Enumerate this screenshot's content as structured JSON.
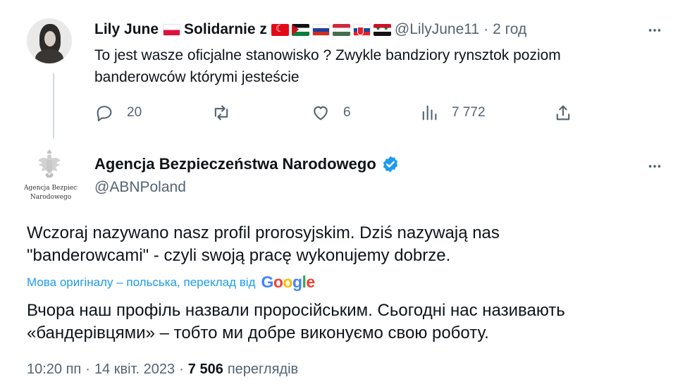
{
  "reply": {
    "display_name": "Lily June",
    "name_suffix": "Solidarnie z",
    "flags": [
      "flag-pl",
      "flag-tr",
      "flag-eh",
      "flag-ru",
      "flag-hu",
      "flag-sk",
      "flag-sy"
    ],
    "handle": "@LilyJune11",
    "separator": "·",
    "time": "2 год",
    "text_line1": "To jest wasze oficjalne stanowisko ? Zwykle bandziory rynsztok poziom",
    "text_line2": "banderowców którymi jesteście",
    "actions": {
      "replies": "20",
      "retweets": "",
      "likes": "6",
      "views": "7 772"
    }
  },
  "main": {
    "display_name": "Agencja Bezpieczeństwa Narodowego",
    "handle": "@ABNPoland",
    "avatar_line1": "Agencja Bezpieczeństwa",
    "avatar_line2": "Narodowego",
    "text_pl_line1": "Wczoraj nazywano nasz profil prorosyjskim. Dziś nazywają nas",
    "text_pl_line2": "\"banderowcami\" - czyli swoją pracę wykonujemy dobrze.",
    "translate_label": "Мова оригіналу – польська, переклад від",
    "translate_provider": "Google",
    "text_ua_line1": "Вчора наш профіль назвали проросійським. Сьогодні нас називають",
    "text_ua_line2": "«бандерівцями» – тобто ми добре виконуємо свою роботу.",
    "timestamp": "10:20 пп",
    "date": "14 квіт. 2023",
    "views_count": "7 506",
    "views_label": "переглядів",
    "dot": "·"
  },
  "colors": {
    "text": "#0f1419",
    "secondary": "#536471",
    "accent": "#1d9bf0",
    "verified": "#1d9bf0"
  }
}
